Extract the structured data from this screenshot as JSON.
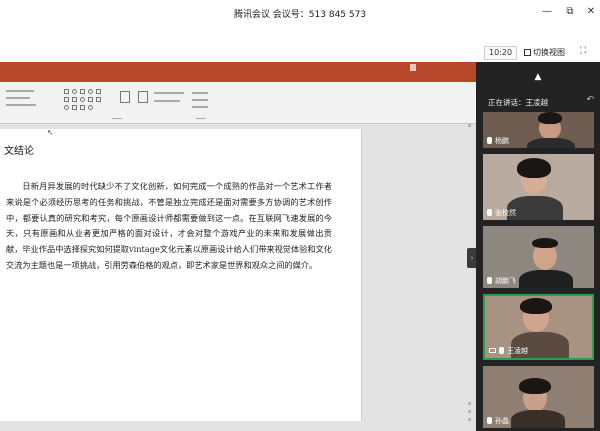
{
  "window": {
    "title": "腾讯会议 会议号：513 845 573",
    "minimize": "—",
    "maximize": "⧉",
    "close": "✕"
  },
  "toolbar": {
    "time": "10:20",
    "switch_view": "切换视图",
    "fullscreen": "⛶"
  },
  "slide": {
    "heading": "文结论",
    "paragraph": "日新月异发展的时代缺少不了文化创新，如何完成一个成熟的作品对一个艺术工作者来说是个必须经历思考的任务和挑战，不管是独立完成还是面对需要多方协调的艺术创作中，都要认真的研究和考究，每个原画设计师都需要做到这一点。在互联网飞速发展的今天，只有原画和从业者更加严格的面对设计，才会对整个游戏产业的未来和发展做出贡献，毕业作品中选择探究如何提取vintage文化元素以原画设计给人们带来视觉体验和文化交流为主题也是一项挑战，引用劳森伯格的观点，即艺术家是世界和观众之间的媒介。"
  },
  "panel": {
    "speaking_label": "正在讲话：王凌越",
    "participants": [
      {
        "name": "杨鹏"
      },
      {
        "name": "张校然"
      },
      {
        "name": "胡鹏飞"
      },
      {
        "name": "王凌越"
      },
      {
        "name": "孙晶"
      }
    ]
  },
  "colors": {
    "ppt_accent": "#b7472a",
    "panel_bg": "#232323",
    "active_border": "#2f9b4f"
  }
}
